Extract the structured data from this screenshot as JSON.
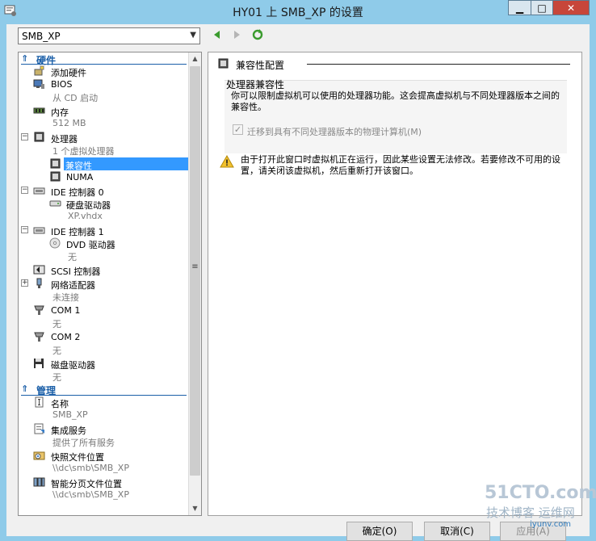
{
  "window": {
    "title": "HY01 上 SMB_XP 的设置",
    "minimize_icon": "minimize-icon",
    "maximize_icon": "maximize-icon",
    "close_icon": "close-icon"
  },
  "vm_selector": {
    "value": "SMB_XP"
  },
  "sidebar": {
    "sections": [
      {
        "label": "硬件",
        "icon": "chevron-up-icon"
      },
      {
        "label": "管理",
        "icon": "chevron-up-icon"
      }
    ],
    "items": [
      {
        "label": "添加硬件",
        "sub": "",
        "icon": "add-hardware-icon"
      },
      {
        "label": "BIOS",
        "sub": "从 CD 启动",
        "icon": "bios-icon"
      },
      {
        "label": "内存",
        "sub": "512 MB",
        "icon": "memory-icon"
      },
      {
        "label": "处理器",
        "sub": "1 个虚拟处理器",
        "icon": "processor-icon"
      },
      {
        "label": "兼容性",
        "sub": "",
        "icon": "processor-icon"
      },
      {
        "label": "NUMA",
        "sub": "",
        "icon": "processor-icon"
      },
      {
        "label": "IDE 控制器 0",
        "sub": "",
        "icon": "ide-controller-icon"
      },
      {
        "label": "硬盘驱动器",
        "sub": "XP.vhdx",
        "icon": "hard-drive-icon"
      },
      {
        "label": "IDE 控制器 1",
        "sub": "",
        "icon": "ide-controller-icon"
      },
      {
        "label": "DVD 驱动器",
        "sub": "无",
        "icon": "dvd-icon"
      },
      {
        "label": "SCSI 控制器",
        "sub": "",
        "icon": "scsi-icon"
      },
      {
        "label": "网络适配器",
        "sub": "未连接",
        "icon": "network-adapter-icon"
      },
      {
        "label": "COM 1",
        "sub": "无",
        "icon": "com-port-icon"
      },
      {
        "label": "COM 2",
        "sub": "无",
        "icon": "com-port-icon"
      },
      {
        "label": "磁盘驱动器",
        "sub": "无",
        "icon": "floppy-icon"
      },
      {
        "label": "名称",
        "sub": "SMB_XP",
        "icon": "name-icon"
      },
      {
        "label": "集成服务",
        "sub": "提供了所有服务",
        "icon": "integration-services-icon"
      },
      {
        "label": "快照文件位置",
        "sub": "\\\\dc\\smb\\SMB_XP",
        "icon": "snapshot-folder-icon"
      },
      {
        "label": "智能分页文件位置",
        "sub": "\\\\dc\\smb\\SMB_XP",
        "icon": "paging-file-icon"
      }
    ]
  },
  "detail": {
    "group_title": "兼容性配置",
    "compat_title": "处理器兼容性",
    "compat_desc": "你可以限制虚拟机可以使用的处理器功能。这会提高虚拟机与不同处理器版本之间的兼容性。",
    "checkbox_label": "迁移到具有不同处理器版本的物理计算机(M)",
    "checkbox_checked": "✓",
    "warning": "由于打开此窗口时虚拟机正在运行，因此某些设置无法修改。若要修改不可用的设置，请关闭该虚拟机，然后重新打开该窗口。"
  },
  "buttons": {
    "ok": "确定(O)",
    "cancel": "取消(C)",
    "apply": "应用(A)"
  },
  "watermark": {
    "main": "51CTO.com",
    "sub": "技术博客  运维网",
    "url": "iyunv.com"
  }
}
